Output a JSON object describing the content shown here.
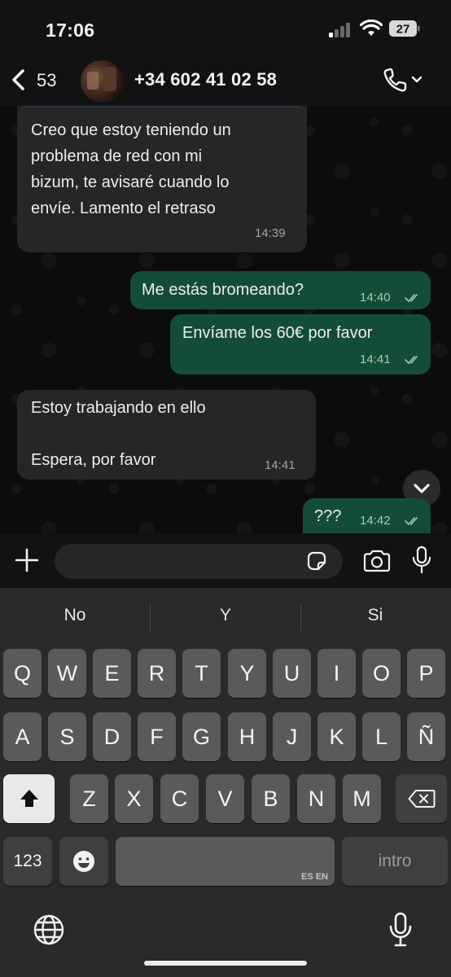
{
  "status_bar": {
    "time": "17:06",
    "battery": "27"
  },
  "header": {
    "back_count": "53",
    "contact_name": "+34 602 41 02 58"
  },
  "messages": [
    {
      "direction": "incoming",
      "text": "Creo que estoy teniendo un\nproblema de red con mi\nbizum, te avisaré cuando lo\nenvíe. Lamento el retraso",
      "time": "14:39"
    },
    {
      "direction": "outgoing",
      "text": "Me estás bromeando?",
      "time": "14:40"
    },
    {
      "direction": "outgoing",
      "text": "Envíame los 60€ por favor",
      "time": "14:41"
    },
    {
      "direction": "incoming",
      "text": "Estoy trabajando en ello\n\nEspera, por favor",
      "time": "14:41"
    },
    {
      "direction": "outgoing",
      "text": "???",
      "time": "14:42"
    }
  ],
  "colors": {
    "incoming_bubble": "#262626",
    "outgoing_bubble": "#144d37",
    "read_ticks": "#a9c7b9"
  },
  "keyboard": {
    "suggestions": [
      "No",
      "Y",
      "Si"
    ],
    "row1": [
      "Q",
      "W",
      "E",
      "R",
      "T",
      "Y",
      "U",
      "I",
      "O",
      "P"
    ],
    "row2": [
      "A",
      "S",
      "D",
      "F",
      "G",
      "H",
      "J",
      "K",
      "L",
      "Ñ"
    ],
    "row3": [
      "Z",
      "X",
      "C",
      "V",
      "B",
      "N",
      "M"
    ],
    "numbers_label": "123",
    "space_language": "ES EN",
    "return_label": "intro"
  }
}
